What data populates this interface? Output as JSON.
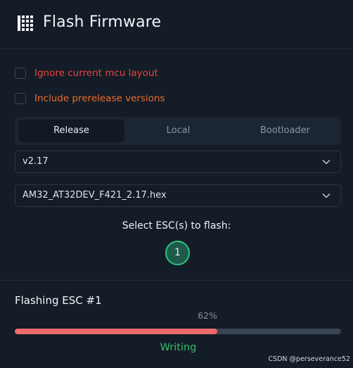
{
  "header": {
    "title": "Flash Firmware",
    "icon": "firmware-grid-icon"
  },
  "options": {
    "ignore_layout": {
      "label": "Ignore current mcu layout",
      "checked": false,
      "color": "#e8453c"
    },
    "include_prerelease": {
      "label": "Include prerelease versions",
      "checked": false,
      "color": "#ee6d2c"
    }
  },
  "tabs": [
    {
      "label": "Release",
      "active": true
    },
    {
      "label": "Local",
      "active": false
    },
    {
      "label": "Bootloader",
      "active": false
    }
  ],
  "version_select": {
    "value": "v2.17",
    "icon": "chevron-down-icon"
  },
  "file_select": {
    "value": "AM32_AT32DEV_F421_2.17.hex",
    "icon": "chevron-down-icon"
  },
  "esc_selection": {
    "label": "Select ESC(s) to flash:",
    "escs": [
      {
        "label": "1",
        "selected": true
      }
    ]
  },
  "flashing": {
    "title": "Flashing ESC #1",
    "percent_text": "62%",
    "progress": 0.62,
    "status": "Writing",
    "status_color": "#2fbf6b",
    "bar_color": "#f06a6d"
  },
  "watermark": "CSDN @perseverance52"
}
